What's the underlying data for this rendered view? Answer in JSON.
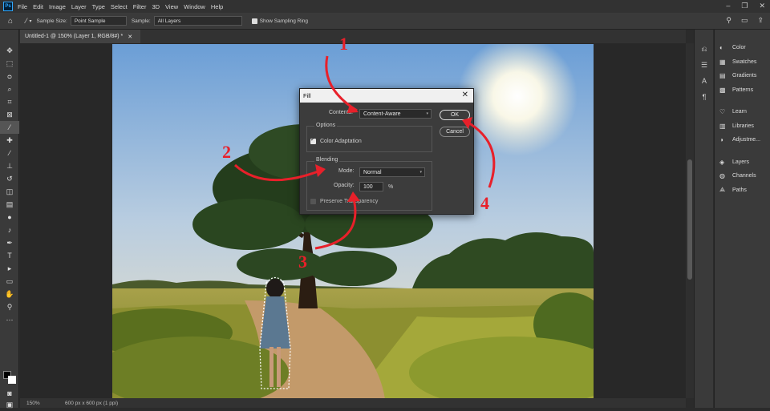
{
  "app": {
    "logo": "Ps"
  },
  "menu": [
    "File",
    "Edit",
    "Image",
    "Layer",
    "Type",
    "Select",
    "Filter",
    "3D",
    "View",
    "Window",
    "Help"
  ],
  "options_bar": {
    "sample_size_label": "Sample Size:",
    "sample_size_value": "Point Sample",
    "sample_label": "Sample:",
    "sample_value": "All Layers",
    "show_ring_label": "Show Sampling Ring"
  },
  "document": {
    "tab_title": "Untitled-1 @ 150% (Layer 1, RGB/8#) *",
    "zoom": "150%",
    "info": "600 px x 600 px (1 ppi)"
  },
  "right_panel": {
    "group1": [
      "Color",
      "Swatches",
      "Gradients",
      "Patterns"
    ],
    "group2": [
      "Learn",
      "Libraries",
      "Adjustme..."
    ],
    "group3": [
      "Layers",
      "Channels",
      "Paths"
    ]
  },
  "fill_dialog": {
    "title": "Fill",
    "contents_label": "Contents:",
    "contents_value": "Content-Aware",
    "options_label": "Options",
    "color_adaptation": "Color Adaptation",
    "blending_label": "Blending",
    "mode_label": "Mode:",
    "mode_value": "Normal",
    "opacity_label": "Opacity:",
    "opacity_value": "100",
    "opacity_unit": "%",
    "preserve_label": "Preserve Transparency",
    "ok_label": "OK",
    "cancel_label": "Cancel"
  },
  "annotations": [
    "1",
    "2",
    "3",
    "4"
  ],
  "colors": {
    "annotation": "#e8202a",
    "photoshop_blue": "#31a8ff"
  }
}
